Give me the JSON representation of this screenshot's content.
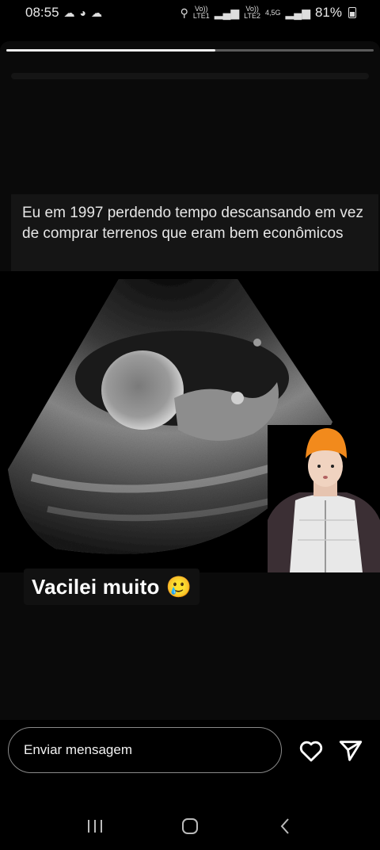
{
  "status_bar": {
    "time": "08:55",
    "left_icons": [
      "cloud-sync-icon",
      "avatar-notification-icon",
      "cloud-sync-icon"
    ],
    "sim1": "Vo))\nLTE1",
    "sim2": "Vo))\nLTE2",
    "network": "4,5G",
    "battery": "81%"
  },
  "story": {
    "progress": 0.57,
    "post_text": "Eu em 1997 perdendo tempo descansando em vez de comprar terrenos que eram bem econômicos",
    "caption": "Vacilei muito",
    "caption_emoji": "🥲"
  },
  "reply": {
    "placeholder": "Enviar mensagem"
  },
  "icons": {
    "like": "heart-icon",
    "share": "send-icon"
  },
  "nav": {
    "recents": "recents-icon",
    "home": "home-icon",
    "back": "back-icon"
  }
}
